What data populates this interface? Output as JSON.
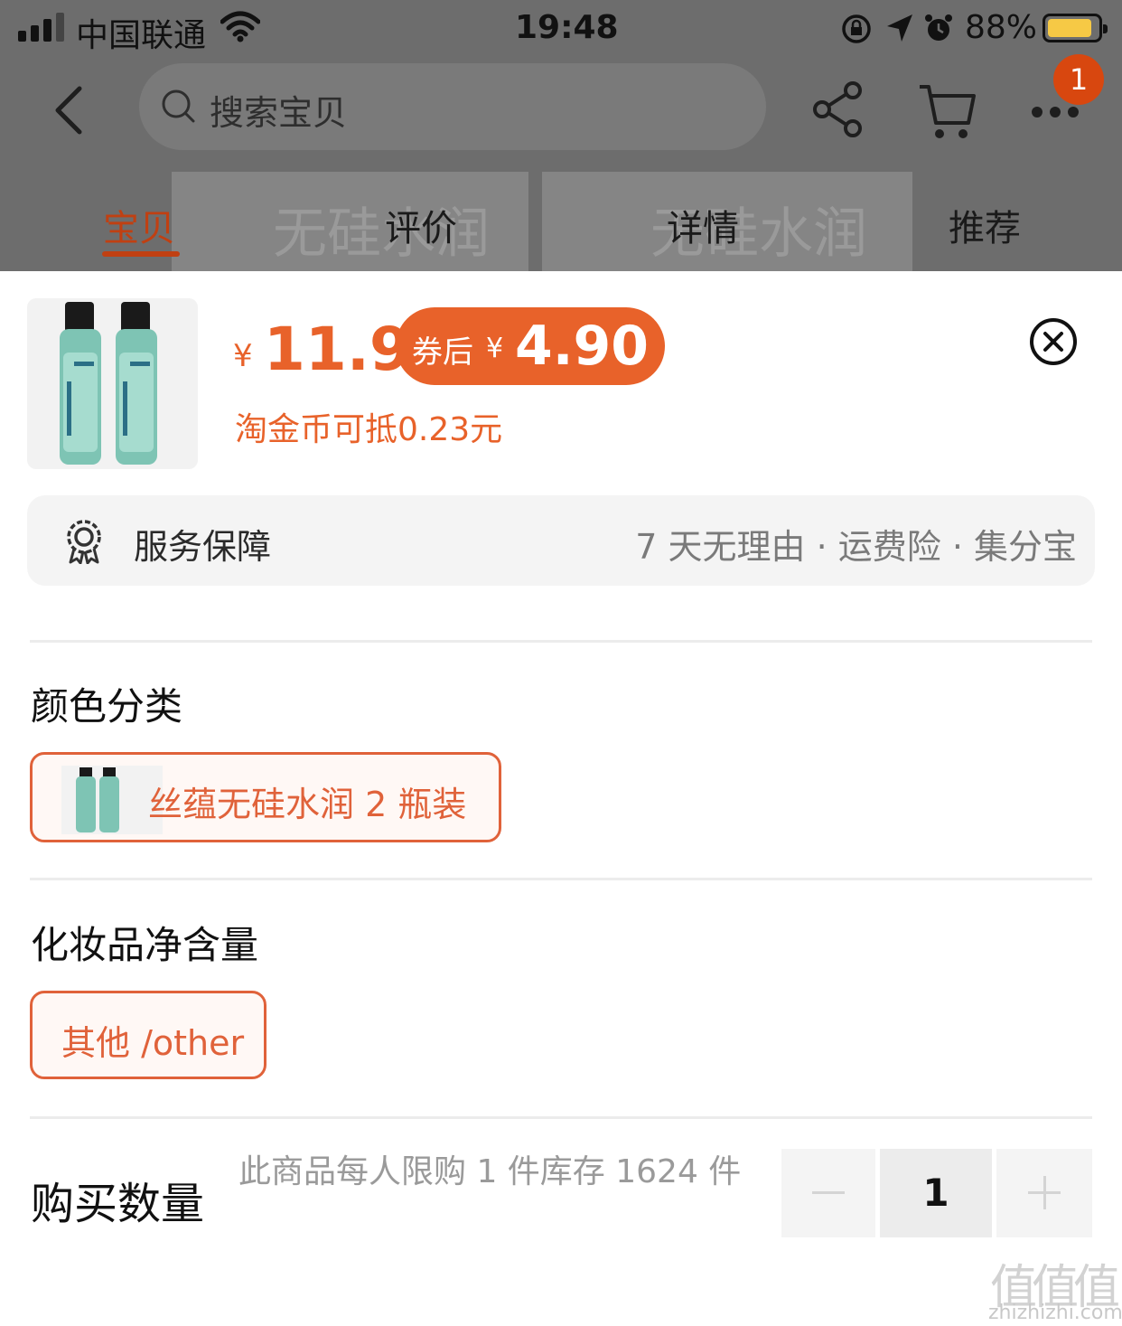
{
  "status_bar": {
    "carrier": "中国联通",
    "time": "19:48",
    "battery": "88%"
  },
  "header": {
    "search_placeholder": "搜索宝贝",
    "cart_badge": "1"
  },
  "background": {
    "text1": "无硅水润",
    "text2": "无硅水润"
  },
  "tabs": [
    {
      "label": "宝贝",
      "active": true
    },
    {
      "label": "评价"
    },
    {
      "label": "详情"
    },
    {
      "label": "推荐"
    }
  ],
  "product": {
    "currency": "¥",
    "price": "11.9",
    "coupon_label": "券后",
    "coupon_currency": "¥",
    "coupon_price": "4.90",
    "taojin_text": "淘金币可抵0.23元"
  },
  "service": {
    "label": "服务保障",
    "value": "7 天无理由 · 运费险 · 集分宝"
  },
  "sections": {
    "color": {
      "title": "颜色分类",
      "option": "丝蕴无硅水润 2 瓶装"
    },
    "volume": {
      "title": "化妆品净含量",
      "option": "其他 /other"
    },
    "quantity": {
      "title": "购买数量",
      "note": "此商品每人限购 1 件库存 1624 件",
      "value": "1"
    }
  },
  "watermark": {
    "main": "值值值",
    "sub": "zhizhizhi.com"
  },
  "colors": {
    "accent": "#e8622a",
    "tab_active": "#c04012",
    "badge": "#d8470f",
    "battery": "#f6c945"
  }
}
